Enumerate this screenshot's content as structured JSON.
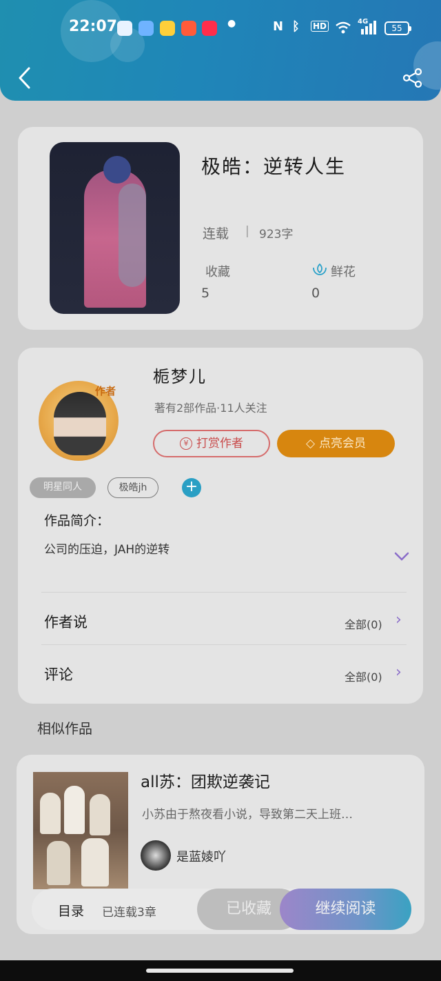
{
  "status_bar": {
    "time": "22:07",
    "network": "4G",
    "battery": "55"
  },
  "header": {
    "back_icon": "chevron-left-icon",
    "share_icon": "share-icon"
  },
  "book": {
    "title": "极皓：逆转人生",
    "status": "连载",
    "separator": "|",
    "word_count": "923字",
    "favorites_label": "收藏",
    "favorites_value": "5",
    "flowers_label": "鲜花",
    "flowers_value": "0"
  },
  "author": {
    "name": "栀梦儿",
    "meta": "著有2部作品·11人关注",
    "badge": "作者",
    "reward_button": "打赏作者",
    "vip_button": "点亮会员"
  },
  "tags": [
    "明星同人",
    "极皓jh"
  ],
  "intro": {
    "heading": "作品简介：",
    "text": "公司的压迫，JAH的逆转"
  },
  "author_says": {
    "label": "作者说",
    "right": "全部(0)"
  },
  "comments": {
    "label": "评论",
    "right": "全部(0)"
  },
  "similar": {
    "heading": "相似作品",
    "items": [
      {
        "title": "all苏：团欺逆袭记",
        "desc": "小苏由于熬夜看小说，导致第二天上班…",
        "author": "是蓝婈吖"
      }
    ]
  },
  "bottom_bar": {
    "catalog": "目录",
    "chapters": "已连载3章",
    "collected": "已收藏",
    "continue": "继续阅读"
  }
}
